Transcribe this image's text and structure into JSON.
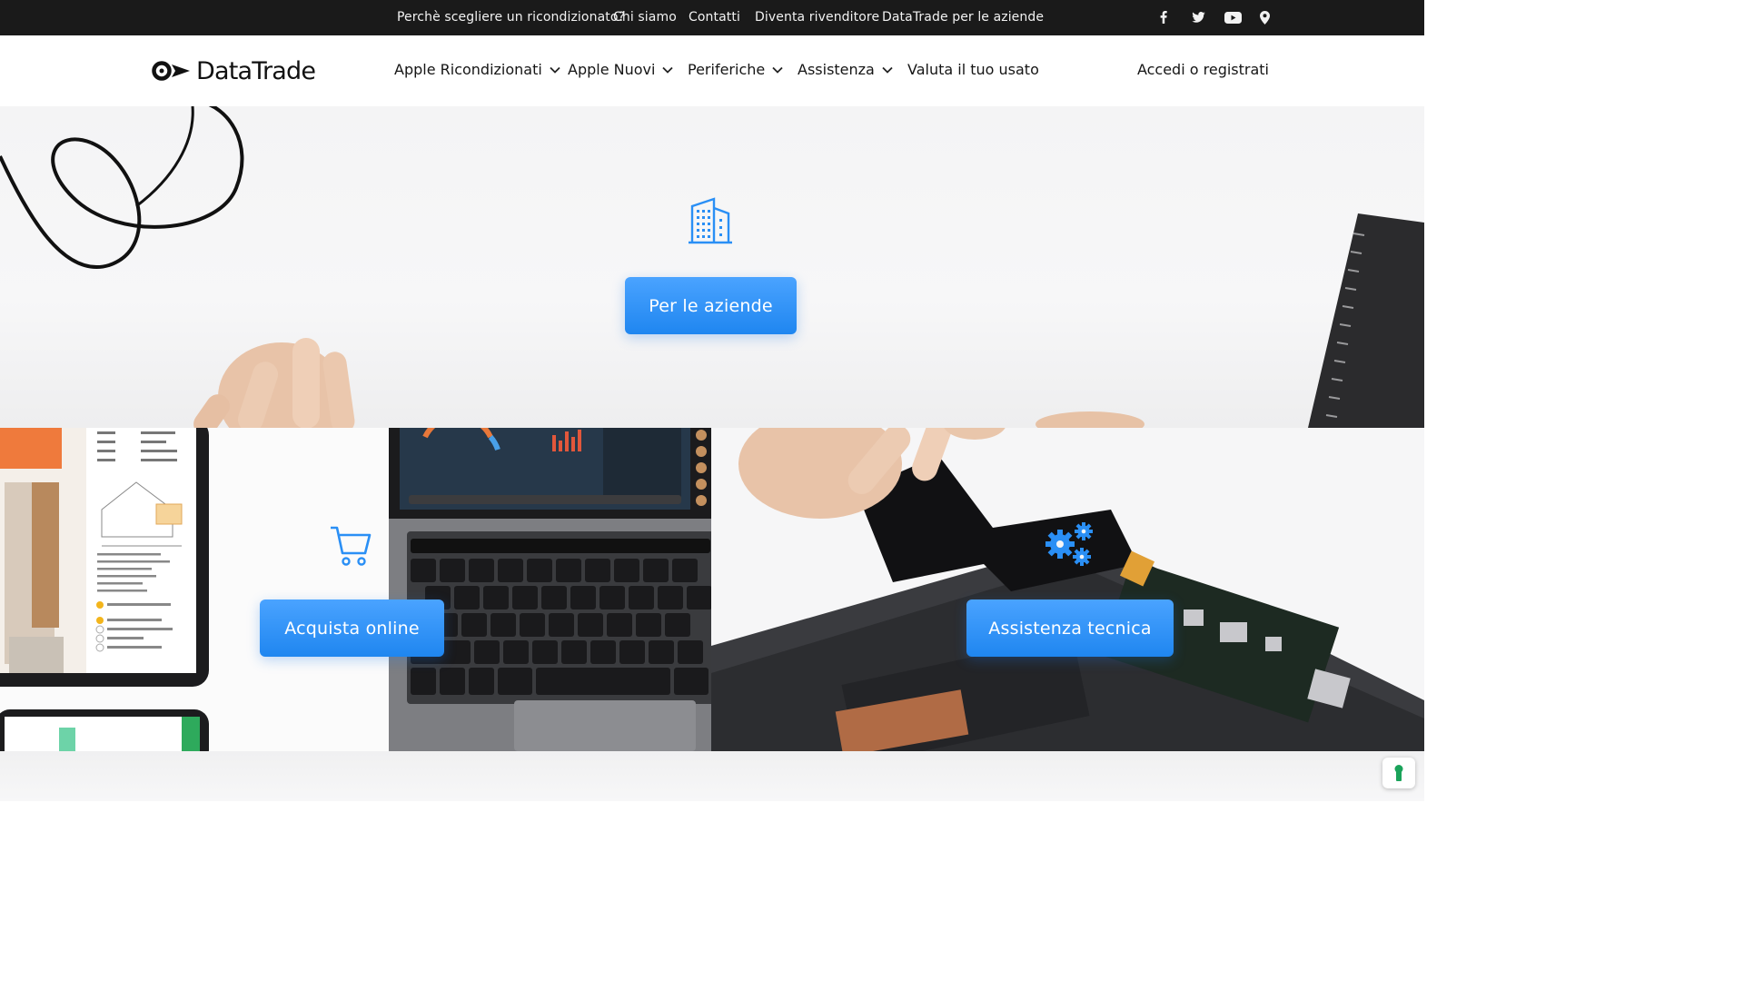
{
  "topbar": {
    "links": [
      "Perchè scegliere un ricondizionato?",
      "Chi siamo",
      "Contatti",
      "Diventa rivenditore",
      "DataTrade per le aziende"
    ],
    "social_icons": [
      "facebook-icon",
      "twitter-icon",
      "youtube-icon",
      "map-pin-icon"
    ]
  },
  "header": {
    "logo_text": "DataTrade",
    "nav": [
      {
        "label": "Apple Ricondizionati",
        "has_dropdown": true
      },
      {
        "label": "Apple Nuovi",
        "has_dropdown": true
      },
      {
        "label": "Periferiche",
        "has_dropdown": true
      },
      {
        "label": "Assistenza",
        "has_dropdown": true
      },
      {
        "label": "Valuta il tuo usato",
        "has_dropdown": false
      }
    ],
    "login_label": "Accedi o registrati"
  },
  "hero": {
    "icon": "building-icon",
    "button_label": "Per le aziende"
  },
  "panels": {
    "left": {
      "icon": "shopping-cart-icon",
      "button_label": "Acquista online"
    },
    "right": {
      "icon": "gears-icon",
      "button_label": "Assistenza tecnica"
    }
  },
  "colors": {
    "topbar_bg": "#1a1a1a",
    "accent_blue": "#2a8ff5",
    "cookie_green": "#1aa35a"
  }
}
